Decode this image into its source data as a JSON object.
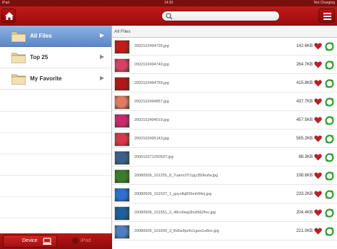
{
  "status_bar": {
    "left": "iPad",
    "time": "14:30",
    "right": "Not Charging"
  },
  "search": {
    "placeholder": ""
  },
  "sidebar": {
    "items": [
      {
        "label": "All Files",
        "active": true
      },
      {
        "label": "Top 25",
        "active": false
      },
      {
        "label": "My Favorite",
        "active": false
      }
    ]
  },
  "bottom_bar": {
    "device_label": "Device",
    "ipod_label": "iPod"
  },
  "main": {
    "breadcrumb": "All Files",
    "files": [
      {
        "name": "2002102494725.jpg",
        "size": "142.6KB",
        "thumb_color": "#c41a1a"
      },
      {
        "name": "2002102494740.jpg",
        "size": "264.7KB",
        "thumb_color": "#d63f66"
      },
      {
        "name": "2002102494759.jpg",
        "size": "415.8KB",
        "thumb_color": "#b01818"
      },
      {
        "name": "2002102494857.jpg",
        "size": "437.7KB",
        "thumb_color": "#e07a62"
      },
      {
        "name": "2002102494919.jpg",
        "size": "457.5KB",
        "thumb_color": "#c92a6b"
      },
      {
        "name": "2002102495143.jpg",
        "size": "565.2KB",
        "thumb_color": "#d8364a"
      },
      {
        "name": "200610271250597.jpg",
        "size": "88.3KB",
        "thumb_color": "#3a5f8c"
      },
      {
        "name": "20080509_101255_8_7uamcf7r1pjy350kufw.jpg",
        "size": "198.6KB",
        "thumb_color": "#3d7a2e"
      },
      {
        "name": "20080509_101537_1_gsynfkj826mh94nj.jpg",
        "size": "233.2KB",
        "thumb_color": "#2b6fd0"
      },
      {
        "name": "20080509_101551_2_48cn0wg2lnzfb62fvu.jpg",
        "size": "204.4KB",
        "thumb_color": "#1f5f9a"
      },
      {
        "name": "20080509_101600_3_lhi5w9pz5v1gsxi1s8ex.jpg",
        "size": "221.0KB",
        "thumb_color": "#4f7fc0"
      }
    ]
  },
  "colors": {
    "accent": "#b51515",
    "heart": "#b5222a",
    "sync": "#2f9e2f",
    "selection": "#6f98d3"
  }
}
